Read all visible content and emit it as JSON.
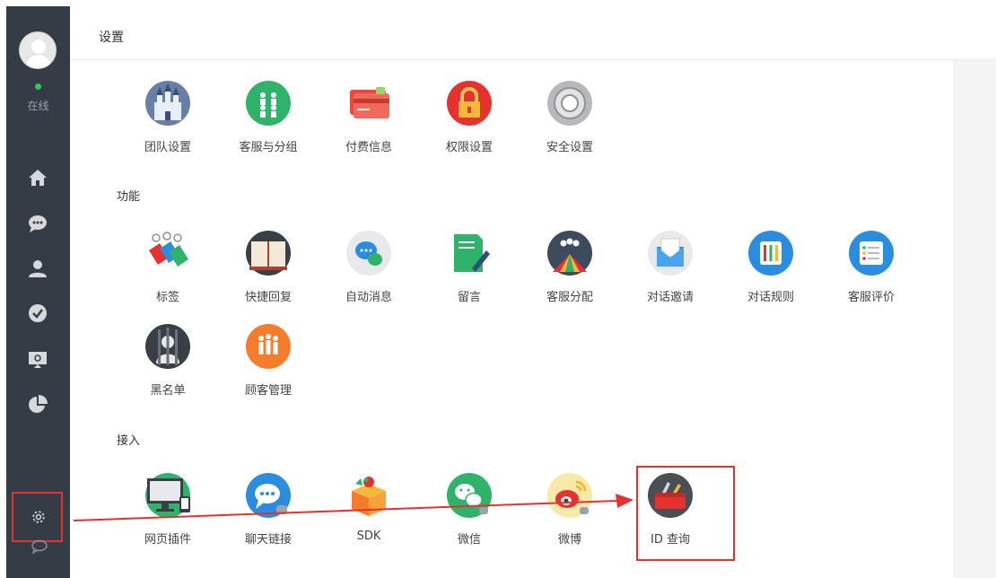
{
  "sidebar": {
    "status": "在线",
    "nav_icons": [
      "home-icon",
      "chat-bubble-icon",
      "user-icon",
      "check-circle-icon",
      "monitor-icon",
      "pie-chart-icon"
    ],
    "settings_icon": "gear-icon",
    "bottom_icon": "chat-outline-icon"
  },
  "header": {
    "title": "设置"
  },
  "sections": {
    "settings": {
      "items": [
        {
          "label": "团队设置",
          "icon": "castle-icon"
        },
        {
          "label": "客服与分组",
          "icon": "group-icon"
        },
        {
          "label": "付费信息",
          "icon": "credit-card-icon"
        },
        {
          "label": "权限设置",
          "icon": "lock-icon"
        },
        {
          "label": "安全设置",
          "icon": "safe-dial-icon"
        }
      ]
    },
    "features": {
      "title": "功能",
      "items": [
        {
          "label": "标签",
          "icon": "tags-icon"
        },
        {
          "label": "快捷回复",
          "icon": "book-icon"
        },
        {
          "label": "自动消息",
          "icon": "auto-message-icon"
        },
        {
          "label": "留言",
          "icon": "note-pen-icon"
        },
        {
          "label": "客服分配",
          "icon": "assign-icon"
        },
        {
          "label": "对话邀请",
          "icon": "envelope-icon"
        },
        {
          "label": "对话规则",
          "icon": "sliders-icon"
        },
        {
          "label": "客服评价",
          "icon": "checklist-icon"
        },
        {
          "label": "黑名单",
          "icon": "blacklist-icon"
        },
        {
          "label": "顾客管理",
          "icon": "customers-icon"
        }
      ]
    },
    "access": {
      "title": "接入",
      "items": [
        {
          "label": "网页插件",
          "icon": "monitor-plugin-icon"
        },
        {
          "label": "聊天链接",
          "icon": "chat-link-icon"
        },
        {
          "label": "SDK",
          "icon": "sdk-box-icon"
        },
        {
          "label": "微信",
          "icon": "wechat-icon"
        },
        {
          "label": "微博",
          "icon": "weibo-icon"
        },
        {
          "label": "ID 查询",
          "icon": "toolbox-icon"
        }
      ]
    }
  },
  "colors": {
    "sidebar_bg": "#343c45",
    "accent_red": "#e5322f",
    "online_green": "#33c85e"
  }
}
